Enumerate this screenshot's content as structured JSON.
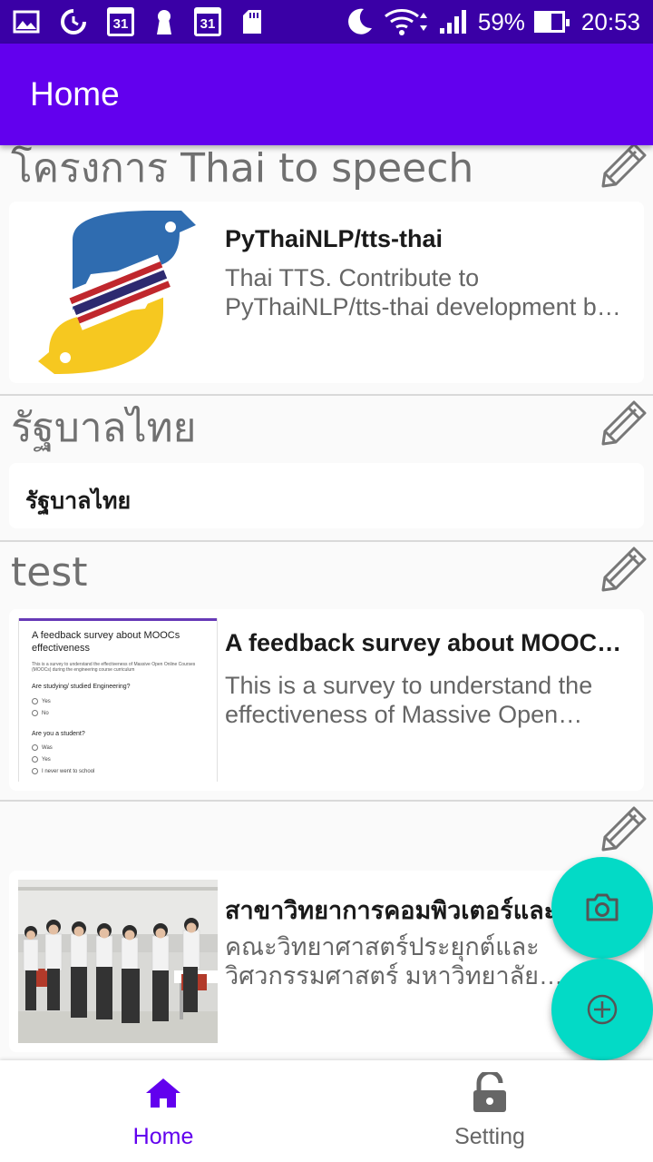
{
  "status_bar": {
    "calendar_day_1": "31",
    "calendar_day_2": "31",
    "battery_percent": "59%",
    "battery_level": 0.59,
    "time": "20:53",
    "left_icons": [
      "gallery-icon",
      "data-saver-icon",
      "calendar-icon",
      "keyhole-icon",
      "calendar-icon",
      "sd-card-icon"
    ],
    "right_icons": [
      "moon-icon",
      "wifi-icon",
      "signal-icon",
      "battery-icon"
    ]
  },
  "app_bar": {
    "title": "Home"
  },
  "groups": [
    {
      "title": "โครงการ Thai to speech",
      "card": {
        "title": "PyThaiNLP/tts-thai",
        "description": "Thai TTS. Contribute to PyThaiNLP/tts-thai development by creating an account on GitHub."
      }
    },
    {
      "title": "รัฐบาลไทย",
      "card": {
        "title": "รัฐบาลไทย"
      }
    },
    {
      "title": "test",
      "card": {
        "title": "A feedback survey about MOOCs effectiveness",
        "description": "This is a survey to understand the effectiveness of Massive Open Online Courses",
        "thumbnail": {
          "heading": "A feedback survey about MOOCs effectiveness",
          "intro": "This is a survey to understand the effectiveness of Massive Open Online Courses (MOOCs) during the engineering course curriculum",
          "question_1": "Are studying/ studied Engineering?",
          "q1_options": [
            "Yes",
            "No"
          ],
          "question_2": "Are you a student?",
          "q2_options": [
            "Was",
            "Yes",
            "I never went to school"
          ]
        }
      }
    },
    {
      "title": "",
      "card": {
        "title": "สาขาวิทยาการคอมพิวเตอร์และ",
        "description": "คณะวิทยาศาสตร์ประยุกต์และวิศวกรรมศาสตร์ มหาวิทยาลัยขอนแก่น"
      }
    }
  ],
  "fabs": {
    "camera_icon": "camera-icon",
    "add_icon": "add-circle-icon"
  },
  "bottom_nav": {
    "items": [
      {
        "label": "Home",
        "icon": "home-icon",
        "active": true
      },
      {
        "label": "Setting",
        "icon": "lock-open-icon",
        "active": false
      }
    ]
  },
  "colors": {
    "status_bar": "#3a00a6",
    "app_bar": "#6200ee",
    "fab": "#03dac6",
    "nav_active": "#6200ee",
    "nav_inactive": "#666666",
    "group_title": "#707070"
  }
}
